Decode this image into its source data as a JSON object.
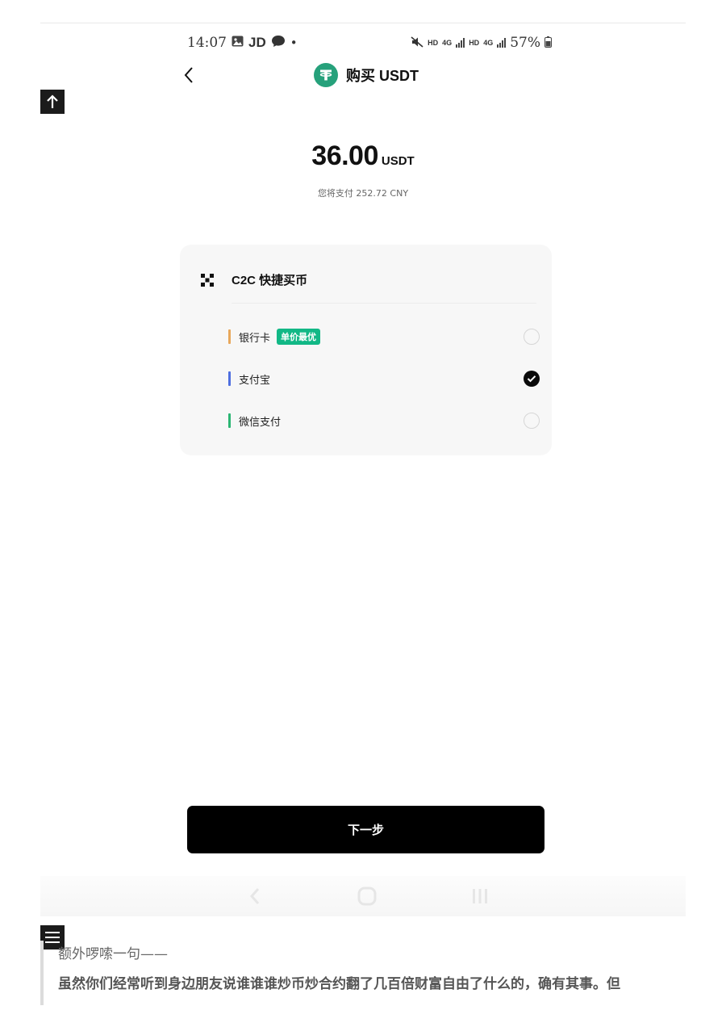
{
  "status_bar": {
    "time": "14:07",
    "app_badge": "JD",
    "dot": "•",
    "hd1": "HD",
    "net1": "4G",
    "hd2": "HD",
    "net2": "4G",
    "battery": "57%"
  },
  "header": {
    "title": "购买 USDT"
  },
  "amount": {
    "value": "36.00",
    "unit": "USDT",
    "pay_text": "您将支付 252.72 CNY"
  },
  "card": {
    "title": "C2C 快捷买币",
    "methods": [
      {
        "label": "银行卡",
        "badge": "单价最优",
        "color": "#e8a85c",
        "checked": false
      },
      {
        "label": "支付宝",
        "color": "#4f6fe0",
        "checked": true
      },
      {
        "label": "微信支付",
        "color": "#2bb673",
        "checked": false
      }
    ]
  },
  "next_button": "下一步",
  "article": {
    "line1": "额外啰嗦一句——",
    "line2": "虽然你们经常听到身边朋友说谁谁谁炒币炒合约翻了几百倍财富自由了什么的，确有其事。但"
  },
  "colors": {
    "tether_green": "#26a17b",
    "badge_green": "#12b886",
    "button_black": "#000000"
  }
}
